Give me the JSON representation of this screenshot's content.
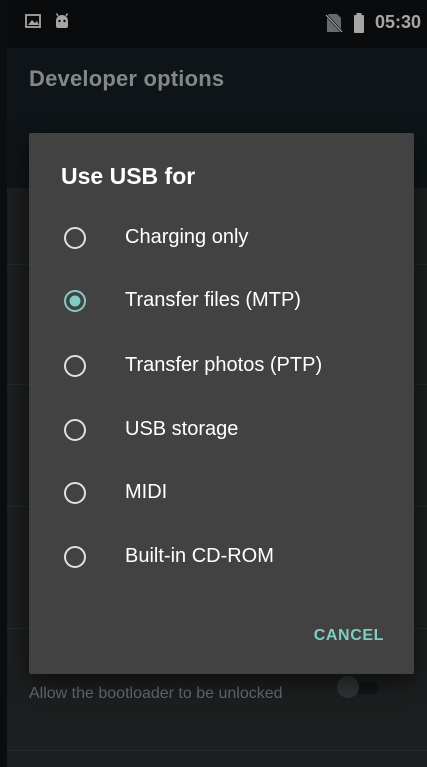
{
  "status_bar": {
    "time": "05:30",
    "icons": [
      "image-icon",
      "android-icon",
      "no-sim-icon",
      "battery-icon"
    ]
  },
  "app_bar": {
    "title": "Developer options"
  },
  "settings": {
    "visible_row_summary": "Allow the bootloader to be unlocked",
    "visible_row_toggle_on": false
  },
  "dialog": {
    "title": "Use USB for",
    "options": [
      {
        "label": "Charging only",
        "selected": false
      },
      {
        "label": "Transfer files (MTP)",
        "selected": true
      },
      {
        "label": "Transfer photos (PTP)",
        "selected": false
      },
      {
        "label": "USB storage",
        "selected": false
      },
      {
        "label": "MIDI",
        "selected": false
      },
      {
        "label": "Built-in CD-ROM",
        "selected": false
      }
    ],
    "cancel_label": "CANCEL"
  },
  "colors": {
    "accent": "#80cbc4",
    "dialog_bg": "#424242",
    "appbar_bg": "#162024",
    "status_bg": "#0f1214"
  }
}
